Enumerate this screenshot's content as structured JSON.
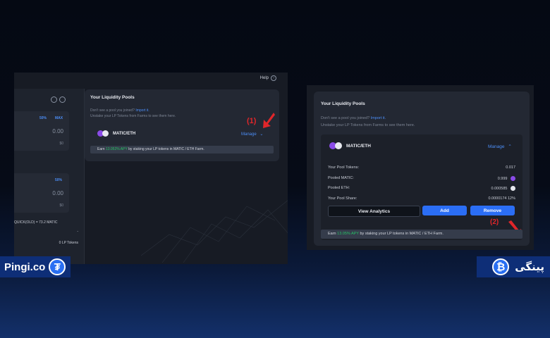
{
  "left_screenshot": {
    "help_label": "Help",
    "help_icon": "question-circle-icon",
    "sidebar": {
      "percent_label": "50%",
      "max_label": "MAX",
      "value_1": "0.00",
      "sub_1": "$0",
      "value_2": "0.00",
      "sub_2": "$0",
      "percent_label_2": "50%",
      "rate_text": "QUICK(OLD) = 73.2 MATIC",
      "dash": "-",
      "lp_tokens": "0 LP Tokens"
    },
    "card": {
      "title": "Your Liquidity Pools",
      "missing_text": "Don't see a pool you joined?",
      "import_link": "Import it.",
      "unstake_text": "Unstake your LP Tokens from Farms to see them here.",
      "pair_name": "MATIC/ETH",
      "manage_label": "Manage",
      "earn_prefix": "Earn",
      "earn_apy": "13.052% APY",
      "earn_suffix": "by staking your LP tokens in MATIC / ETH Farm."
    },
    "annotation": "(1)"
  },
  "right_screenshot": {
    "title": "Your Liquidity Pools",
    "missing_text": "Don't see a pool you joined?",
    "import_link": "Import it.",
    "unstake_text": "Unstake your LP Tokens from Farms to see them here.",
    "pair_name": "MATIC/ETH",
    "manage_label": "Manage",
    "rows": [
      {
        "label": "Your Pool Tokens:",
        "value": "0.017"
      },
      {
        "label": "Pooled MATIC:",
        "value": "0.999"
      },
      {
        "label": "Pooled ETH:",
        "value": "0.000585"
      },
      {
        "label": "Your Pool Share:",
        "value": "0.0000174 12%"
      }
    ],
    "buttons": {
      "analytics": "View Analytics",
      "add": "Add",
      "remove": "Remove"
    },
    "annotation": "(2)",
    "earn_prefix": "Earn",
    "earn_apy": "13.05% APY",
    "earn_suffix": "by staking your LP tokens in MATIC / ETH Farm."
  },
  "branding": {
    "left_text": "Pingi.co",
    "left_icon": "tether-icon",
    "right_text": "پینگی",
    "right_icon": "bitcoin-icon"
  },
  "colors": {
    "accent_blue": "#2b6ef5",
    "apy_green": "#27c266",
    "annotation_red": "#e0262a",
    "brand_bar": "#0e2e77"
  }
}
